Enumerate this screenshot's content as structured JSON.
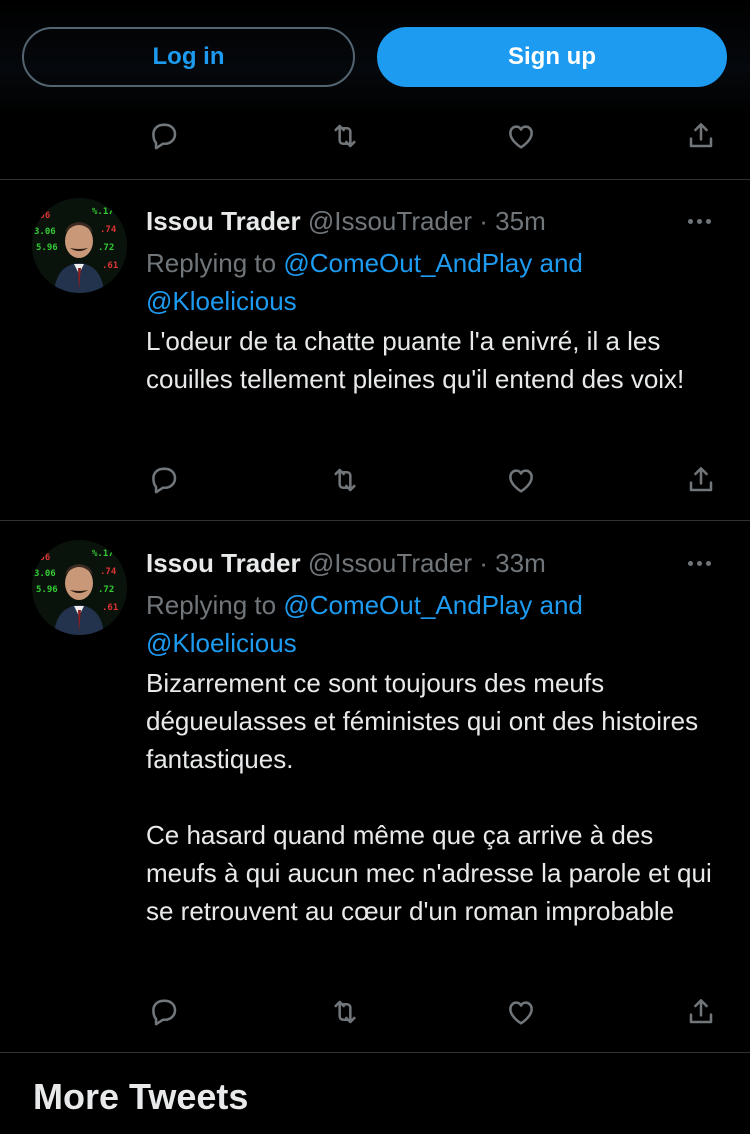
{
  "auth": {
    "login_label": "Log in",
    "signup_label": "Sign up"
  },
  "tweets": [
    {
      "name": "Issou Trader",
      "handle": "@IssouTrader",
      "separator": "·",
      "time": "35m",
      "replying_prefix": "Replying to",
      "mention1": "@ComeOut_AndPlay",
      "and": "and",
      "mention2": "@Kloelicious",
      "paragraphs": [
        "L'odeur de ta chatte puante l'a enivré, il a les couilles tellement pleines qu'il entend des voix!"
      ]
    },
    {
      "name": "Issou Trader",
      "handle": "@IssouTrader",
      "separator": "·",
      "time": "33m",
      "replying_prefix": "Replying to",
      "mention1": "@ComeOut_AndPlay",
      "and": "and",
      "mention2": "@Kloelicious",
      "paragraphs": [
        "Bizarrement ce sont toujours des meufs dégueulasses et féministes qui ont des histoires fantastiques.",
        "Ce hasard quand même que ça arrive à des meufs à qui aucun mec n'adresse la parole et qui se retrouvent au cœur d'un roman improbable"
      ]
    }
  ],
  "section": {
    "more_tweets": "More Tweets"
  },
  "icons": {
    "reply": "reply-icon",
    "retweet": "retweet-icon",
    "like": "like-icon",
    "share": "share-icon",
    "more": "more-dots-icon"
  },
  "colors": {
    "background": "#000000",
    "accent": "#1d9bf0",
    "text": "#e7e9ea",
    "muted": "#71767b",
    "divider": "#2f3336"
  }
}
